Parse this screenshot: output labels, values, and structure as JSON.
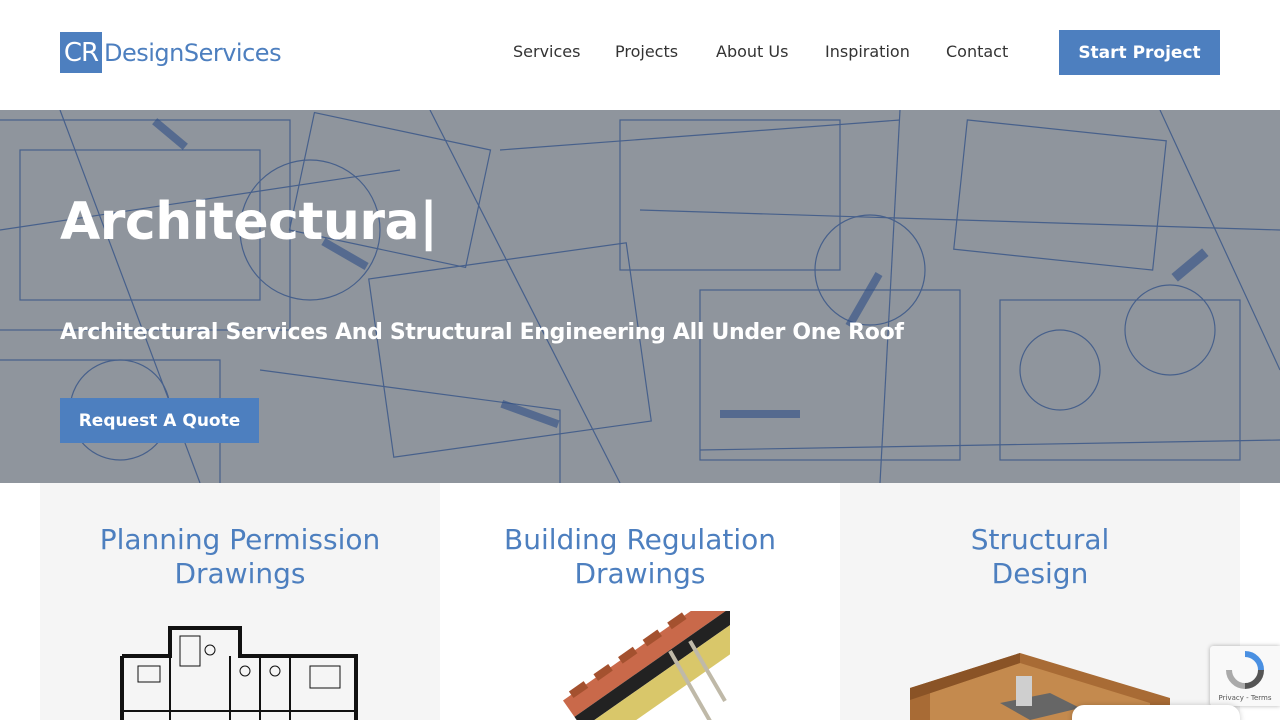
{
  "brand": {
    "logo_mark": "CR",
    "logo_text": "DesignServices",
    "accent": "#4d7fbf"
  },
  "nav": {
    "items": [
      "Services",
      "Projects",
      "About Us",
      "Inspiration",
      "Contact"
    ],
    "cta_label": "Start Project"
  },
  "hero": {
    "title": "Architectura|",
    "subtitle": "Architectural Services And Structural Engineering All Under One Roof",
    "button_label": "Request A Quote"
  },
  "cards": [
    {
      "title_line1": "Planning Permission",
      "title_line2": "Drawings",
      "image": "floor-plan-image"
    },
    {
      "title_line1": "Building Regulation",
      "title_line2": "Drawings",
      "image": "roof-section-image"
    },
    {
      "title_line1": "Structural",
      "title_line2": "Design",
      "image": "timber-joint-image"
    }
  ],
  "recaptcha": {
    "footer_text": "Privacy - Terms",
    "icon": "recaptcha-icon"
  }
}
